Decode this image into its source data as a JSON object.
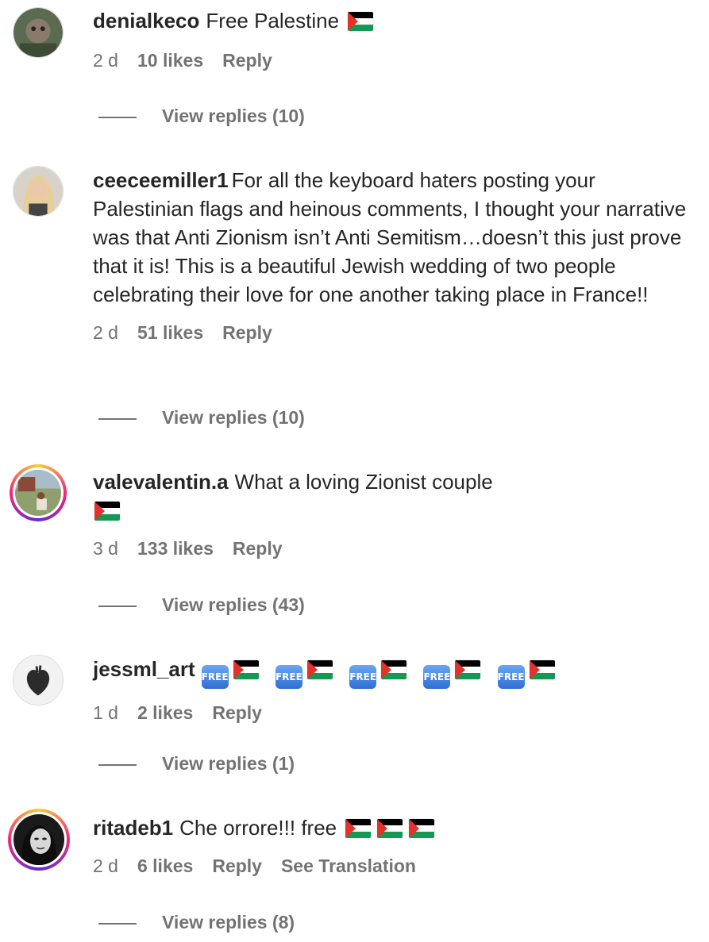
{
  "comments": [
    {
      "username": "denialkeco",
      "text": "Free Palestine",
      "flags_after_text": 1,
      "age": "2 d",
      "likes": "10 likes",
      "reply": "Reply",
      "view_replies": "View replies (10)",
      "avatar_style": "plain"
    },
    {
      "username": "ceeceemiller1",
      "text": "For all the keyboard haters posting your Palestinian flags and heinous comments, I thought your narrative was that Anti Zionism isn’t Anti Semitism…doesn’t this just prove that it is! This is a beautiful Jewish wedding of two people celebrating their love for one another taking place in France!!",
      "age": "2 d",
      "likes": "51 likes",
      "reply": "Reply",
      "view_replies": "View replies (10)",
      "avatar_style": "plain"
    },
    {
      "username": "valevalentin.a",
      "text": "What a loving Zionist couple",
      "flags_after_text": 1,
      "age": "3 d",
      "likes": "133 likes",
      "reply": "Reply",
      "view_replies": "View replies (43)",
      "avatar_style": "story"
    },
    {
      "username": "jessml_art",
      "free_badge_label": "FREE",
      "free_flag_pairs": 5,
      "age": "1 d",
      "likes": "2 likes",
      "reply": "Reply",
      "view_replies": "View replies (1)",
      "avatar_style": "plain"
    },
    {
      "username": "ritadeb1",
      "text": "Che orrore!!! free",
      "flags_after_text": 3,
      "age": "2 d",
      "likes": "6 likes",
      "reply": "Reply",
      "see_translation": "See Translation",
      "view_replies": "View replies (8)",
      "avatar_style": "story"
    }
  ],
  "colors": {
    "text": "#262626",
    "secondary": "#737373",
    "flag_black": "#000000",
    "flag_white": "#ffffff",
    "flag_green": "#149954",
    "flag_red": "#e4312b"
  }
}
